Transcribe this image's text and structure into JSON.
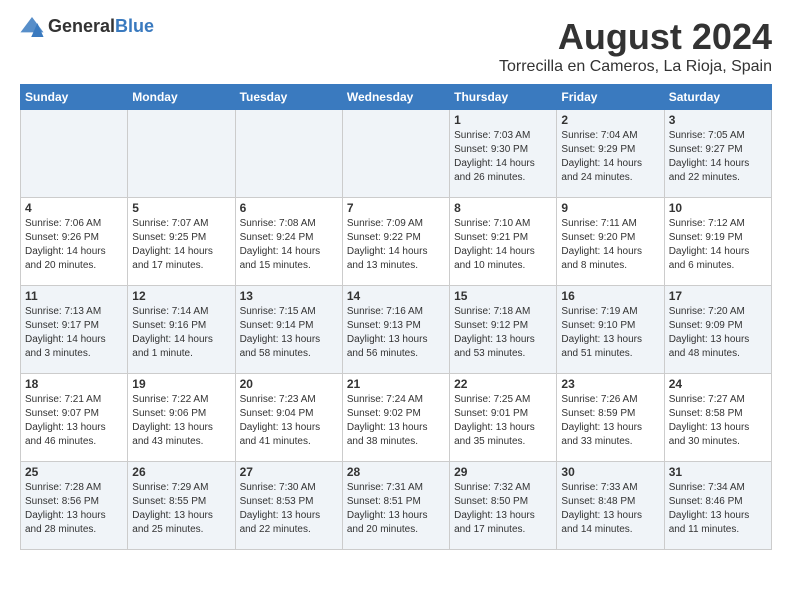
{
  "header": {
    "logo_general": "General",
    "logo_blue": "Blue",
    "month_year": "August 2024",
    "location": "Torrecilla en Cameros, La Rioja, Spain"
  },
  "days_of_week": [
    "Sunday",
    "Monday",
    "Tuesday",
    "Wednesday",
    "Thursday",
    "Friday",
    "Saturday"
  ],
  "weeks": [
    [
      {
        "day": "",
        "info": ""
      },
      {
        "day": "",
        "info": ""
      },
      {
        "day": "",
        "info": ""
      },
      {
        "day": "",
        "info": ""
      },
      {
        "day": "1",
        "info": "Sunrise: 7:03 AM\nSunset: 9:30 PM\nDaylight: 14 hours\nand 26 minutes."
      },
      {
        "day": "2",
        "info": "Sunrise: 7:04 AM\nSunset: 9:29 PM\nDaylight: 14 hours\nand 24 minutes."
      },
      {
        "day": "3",
        "info": "Sunrise: 7:05 AM\nSunset: 9:27 PM\nDaylight: 14 hours\nand 22 minutes."
      }
    ],
    [
      {
        "day": "4",
        "info": "Sunrise: 7:06 AM\nSunset: 9:26 PM\nDaylight: 14 hours\nand 20 minutes."
      },
      {
        "day": "5",
        "info": "Sunrise: 7:07 AM\nSunset: 9:25 PM\nDaylight: 14 hours\nand 17 minutes."
      },
      {
        "day": "6",
        "info": "Sunrise: 7:08 AM\nSunset: 9:24 PM\nDaylight: 14 hours\nand 15 minutes."
      },
      {
        "day": "7",
        "info": "Sunrise: 7:09 AM\nSunset: 9:22 PM\nDaylight: 14 hours\nand 13 minutes."
      },
      {
        "day": "8",
        "info": "Sunrise: 7:10 AM\nSunset: 9:21 PM\nDaylight: 14 hours\nand 10 minutes."
      },
      {
        "day": "9",
        "info": "Sunrise: 7:11 AM\nSunset: 9:20 PM\nDaylight: 14 hours\nand 8 minutes."
      },
      {
        "day": "10",
        "info": "Sunrise: 7:12 AM\nSunset: 9:19 PM\nDaylight: 14 hours\nand 6 minutes."
      }
    ],
    [
      {
        "day": "11",
        "info": "Sunrise: 7:13 AM\nSunset: 9:17 PM\nDaylight: 14 hours\nand 3 minutes."
      },
      {
        "day": "12",
        "info": "Sunrise: 7:14 AM\nSunset: 9:16 PM\nDaylight: 14 hours\nand 1 minute."
      },
      {
        "day": "13",
        "info": "Sunrise: 7:15 AM\nSunset: 9:14 PM\nDaylight: 13 hours\nand 58 minutes."
      },
      {
        "day": "14",
        "info": "Sunrise: 7:16 AM\nSunset: 9:13 PM\nDaylight: 13 hours\nand 56 minutes."
      },
      {
        "day": "15",
        "info": "Sunrise: 7:18 AM\nSunset: 9:12 PM\nDaylight: 13 hours\nand 53 minutes."
      },
      {
        "day": "16",
        "info": "Sunrise: 7:19 AM\nSunset: 9:10 PM\nDaylight: 13 hours\nand 51 minutes."
      },
      {
        "day": "17",
        "info": "Sunrise: 7:20 AM\nSunset: 9:09 PM\nDaylight: 13 hours\nand 48 minutes."
      }
    ],
    [
      {
        "day": "18",
        "info": "Sunrise: 7:21 AM\nSunset: 9:07 PM\nDaylight: 13 hours\nand 46 minutes."
      },
      {
        "day": "19",
        "info": "Sunrise: 7:22 AM\nSunset: 9:06 PM\nDaylight: 13 hours\nand 43 minutes."
      },
      {
        "day": "20",
        "info": "Sunrise: 7:23 AM\nSunset: 9:04 PM\nDaylight: 13 hours\nand 41 minutes."
      },
      {
        "day": "21",
        "info": "Sunrise: 7:24 AM\nSunset: 9:02 PM\nDaylight: 13 hours\nand 38 minutes."
      },
      {
        "day": "22",
        "info": "Sunrise: 7:25 AM\nSunset: 9:01 PM\nDaylight: 13 hours\nand 35 minutes."
      },
      {
        "day": "23",
        "info": "Sunrise: 7:26 AM\nSunset: 8:59 PM\nDaylight: 13 hours\nand 33 minutes."
      },
      {
        "day": "24",
        "info": "Sunrise: 7:27 AM\nSunset: 8:58 PM\nDaylight: 13 hours\nand 30 minutes."
      }
    ],
    [
      {
        "day": "25",
        "info": "Sunrise: 7:28 AM\nSunset: 8:56 PM\nDaylight: 13 hours\nand 28 minutes."
      },
      {
        "day": "26",
        "info": "Sunrise: 7:29 AM\nSunset: 8:55 PM\nDaylight: 13 hours\nand 25 minutes."
      },
      {
        "day": "27",
        "info": "Sunrise: 7:30 AM\nSunset: 8:53 PM\nDaylight: 13 hours\nand 22 minutes."
      },
      {
        "day": "28",
        "info": "Sunrise: 7:31 AM\nSunset: 8:51 PM\nDaylight: 13 hours\nand 20 minutes."
      },
      {
        "day": "29",
        "info": "Sunrise: 7:32 AM\nSunset: 8:50 PM\nDaylight: 13 hours\nand 17 minutes."
      },
      {
        "day": "30",
        "info": "Sunrise: 7:33 AM\nSunset: 8:48 PM\nDaylight: 13 hours\nand 14 minutes."
      },
      {
        "day": "31",
        "info": "Sunrise: 7:34 AM\nSunset: 8:46 PM\nDaylight: 13 hours\nand 11 minutes."
      }
    ]
  ]
}
